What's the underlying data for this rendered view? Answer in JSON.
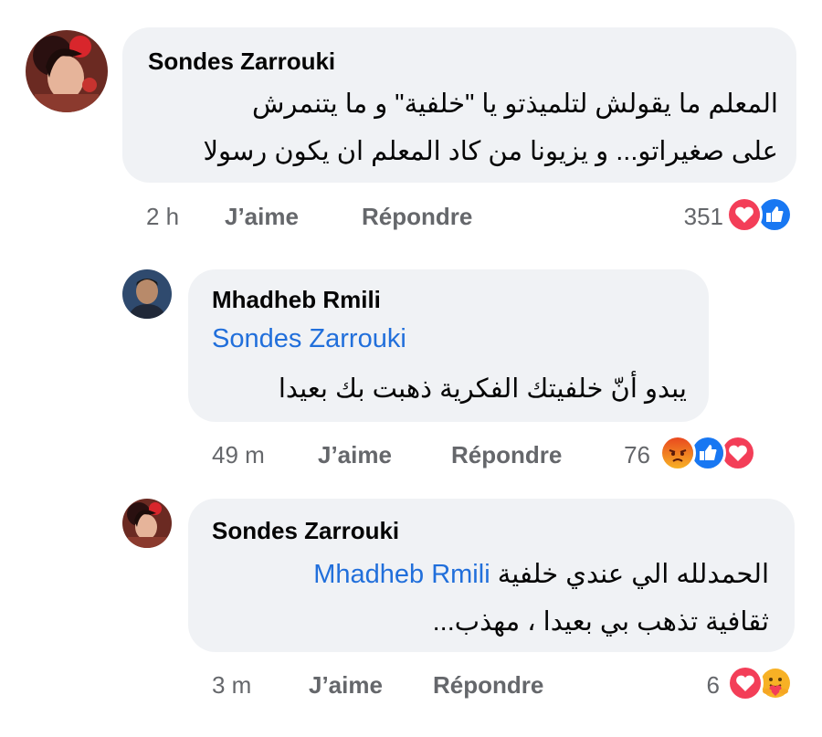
{
  "comments": [
    {
      "author": "Sondes Zarrouki",
      "line1": "المعلم ما يقولش لتلميذتو يا \"خلفية\" و ما يتنمرش",
      "line2": "على صغيراتو... و يزيونا من كاد المعلم ان يكون رسولا",
      "time": "2 h",
      "like_label": "J’aime",
      "reply_label": "Répondre",
      "reaction_count": "351",
      "reactions": [
        "love-reaction-icon",
        "like-reaction-icon"
      ]
    },
    {
      "author": "Mhadheb Rmili",
      "mention": "Sondes Zarrouki",
      "line1": "يبدو أنّ خلفيتك الفكرية ذهبت بك بعيدا",
      "time": "49 m",
      "like_label": "J’aime",
      "reply_label": "Répondre",
      "reaction_count": "76",
      "reactions": [
        "angry-reaction-icon",
        "like-reaction-icon",
        "love-reaction-icon"
      ]
    },
    {
      "author": "Sondes Zarrouki",
      "mention": "Mhadheb Rmili",
      "line1_rest": "الحمدلله الي عندي خلفية",
      "line2": "ثقافية تذهب بي بعيدا ، مهذب...",
      "time": "3 m",
      "like_label": "J’aime",
      "reply_label": "Répondre",
      "reaction_count": "6",
      "reactions": [
        "love-reaction-icon",
        "care-reaction-icon"
      ]
    }
  ],
  "colors": {
    "bubble": "#f0f2f5",
    "link": "#216fdb",
    "meta": "#65676b",
    "like": "#1877f2",
    "love": "#f33e58",
    "angry": "#f7714b"
  }
}
